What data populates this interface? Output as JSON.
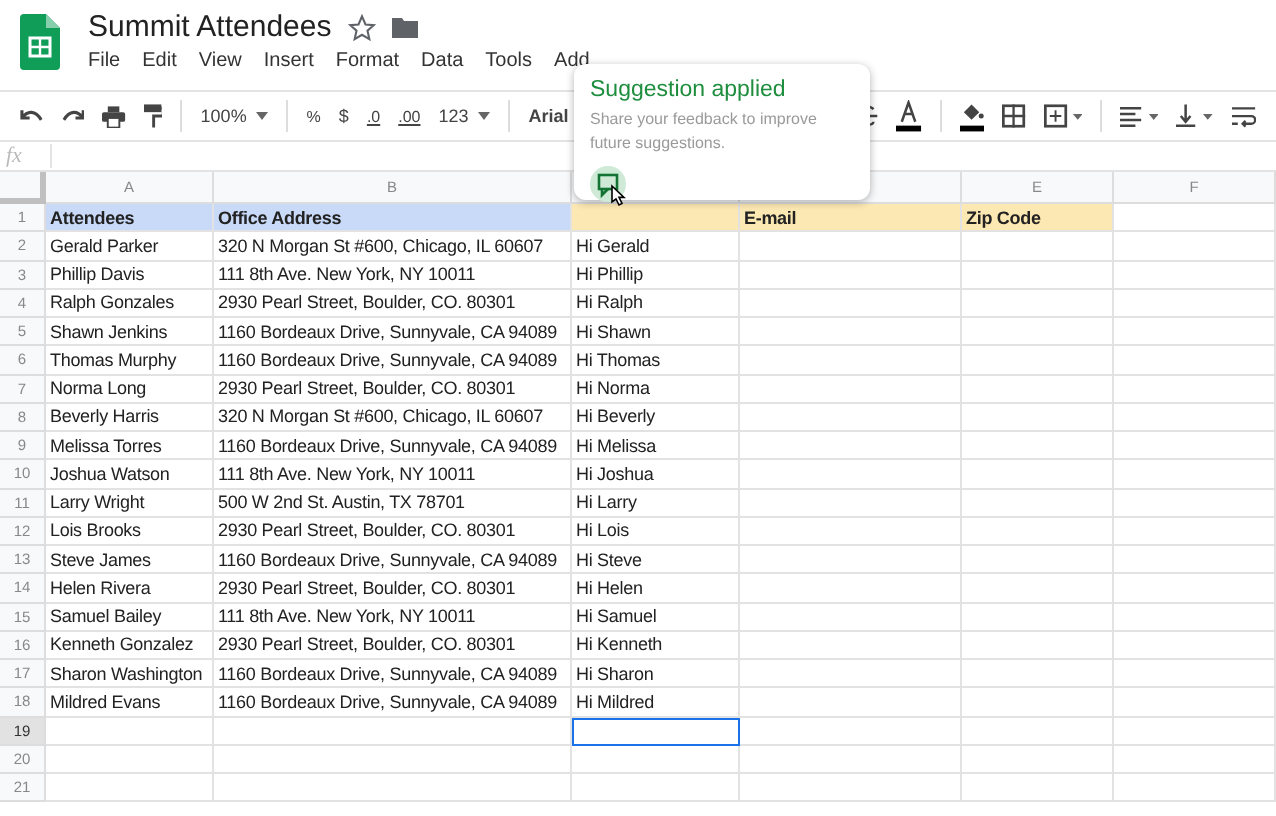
{
  "document": {
    "title": "Summit Attendees",
    "starred": false
  },
  "menu": [
    "File",
    "Edit",
    "View",
    "Insert",
    "Format",
    "Data",
    "Tools",
    "Add"
  ],
  "toolbar": {
    "zoom": "100%",
    "percent": "%",
    "currency": "$",
    "decrease_decimals": ".0",
    "increase_decimals": ".00",
    "number_format": "123",
    "font": "Arial"
  },
  "formula_bar": {
    "label": "fx"
  },
  "popup": {
    "title": "Suggestion applied",
    "message": "Share your feedback to improve future suggestions."
  },
  "columns": [
    {
      "label": "A"
    },
    {
      "label": "B"
    },
    {},
    {},
    {
      "label": "E"
    },
    {
      "label": "F"
    }
  ],
  "rows": [
    {
      "number": "1",
      "cells": [
        {
          "text": "Attendees",
          "color": "#c9daf8",
          "selected": false
        },
        {
          "text": "Office Address",
          "color": "#c9daf8",
          "selected": false
        },
        {
          "color": "#fce8b2",
          "selected": false
        },
        {
          "text": "E-mail",
          "color": "#fce8b2",
          "selected": false
        },
        {
          "text": "Zip Code",
          "color": "#fce8b2",
          "selected": false
        },
        {
          "selected": false
        }
      ]
    },
    {
      "number": "2",
      "cells": [
        {
          "text": "Gerald Parker",
          "selected": false
        },
        {
          "text": "320 N Morgan St #600, Chicago, IL 60607",
          "selected": false
        },
        {
          "text": "Hi Gerald",
          "selected": false
        },
        {
          "selected": false
        },
        {
          "selected": false
        },
        {
          "selected": false
        }
      ]
    },
    {
      "number": "3",
      "cells": [
        {
          "text": "Phillip Davis",
          "selected": false
        },
        {
          "text": "111 8th Ave. New York, NY 10011",
          "selected": false
        },
        {
          "text": "Hi Phillip",
          "selected": false
        },
        {
          "selected": false
        },
        {
          "selected": false
        },
        {
          "selected": false
        }
      ]
    },
    {
      "number": "4",
      "cells": [
        {
          "text": "Ralph Gonzales",
          "selected": false
        },
        {
          "text": "2930 Pearl Street, Boulder, CO. 80301",
          "selected": false
        },
        {
          "text": "Hi Ralph",
          "selected": false
        },
        {
          "selected": false
        },
        {
          "selected": false
        },
        {
          "selected": false
        }
      ]
    },
    {
      "number": "5",
      "cells": [
        {
          "text": "Shawn Jenkins",
          "selected": false
        },
        {
          "text": "1160 Bordeaux Drive, Sunnyvale, CA 94089",
          "selected": false
        },
        {
          "text": "Hi Shawn",
          "selected": false
        },
        {
          "selected": false
        },
        {
          "selected": false
        },
        {
          "selected": false
        }
      ]
    },
    {
      "number": "6",
      "cells": [
        {
          "text": "Thomas Murphy",
          "selected": false
        },
        {
          "text": "1160 Bordeaux Drive, Sunnyvale, CA 94089",
          "selected": false
        },
        {
          "text": "Hi Thomas",
          "selected": false
        },
        {
          "selected": false
        },
        {
          "selected": false
        },
        {
          "selected": false
        }
      ]
    },
    {
      "number": "7",
      "cells": [
        {
          "text": "Norma Long",
          "selected": false
        },
        {
          "text": "2930 Pearl Street, Boulder, CO. 80301",
          "selected": false
        },
        {
          "text": "Hi Norma",
          "selected": false
        },
        {
          "selected": false
        },
        {
          "selected": false
        },
        {
          "selected": false
        }
      ]
    },
    {
      "number": "8",
      "cells": [
        {
          "text": "Beverly Harris",
          "selected": false
        },
        {
          "text": "320 N Morgan St #600, Chicago, IL 60607",
          "selected": false
        },
        {
          "text": "Hi Beverly",
          "selected": false
        },
        {
          "selected": false
        },
        {
          "selected": false
        },
        {
          "selected": false
        }
      ]
    },
    {
      "number": "9",
      "cells": [
        {
          "text": "Melissa Torres",
          "selected": false
        },
        {
          "text": "1160 Bordeaux Drive, Sunnyvale, CA 94089",
          "selected": false
        },
        {
          "text": "Hi Melissa",
          "selected": false
        },
        {
          "selected": false
        },
        {
          "selected": false
        },
        {
          "selected": false
        }
      ]
    },
    {
      "number": "10",
      "cells": [
        {
          "text": "Joshua Watson",
          "selected": false
        },
        {
          "text": "111 8th Ave. New York, NY 10011",
          "selected": false
        },
        {
          "text": "Hi Joshua",
          "selected": false
        },
        {
          "selected": false
        },
        {
          "selected": false
        },
        {
          "selected": false
        }
      ]
    },
    {
      "number": "11",
      "cells": [
        {
          "text": "Larry Wright",
          "selected": false
        },
        {
          "text": "500 W 2nd St. Austin, TX 78701",
          "selected": false
        },
        {
          "text": "Hi Larry",
          "selected": false
        },
        {
          "selected": false
        },
        {
          "selected": false
        },
        {
          "selected": false
        }
      ]
    },
    {
      "number": "12",
      "cells": [
        {
          "text": "Lois Brooks",
          "selected": false
        },
        {
          "text": "2930 Pearl Street, Boulder, CO. 80301",
          "selected": false
        },
        {
          "text": "Hi Lois",
          "selected": false
        },
        {
          "selected": false
        },
        {
          "selected": false
        },
        {
          "selected": false
        }
      ]
    },
    {
      "number": "13",
      "cells": [
        {
          "text": "Steve James",
          "selected": false
        },
        {
          "text": "1160 Bordeaux Drive, Sunnyvale, CA 94089",
          "selected": false
        },
        {
          "text": "Hi Steve",
          "selected": false
        },
        {
          "selected": false
        },
        {
          "selected": false
        },
        {
          "selected": false
        }
      ]
    },
    {
      "number": "14",
      "cells": [
        {
          "text": "Helen Rivera",
          "selected": false
        },
        {
          "text": "2930 Pearl Street, Boulder, CO. 80301",
          "selected": false
        },
        {
          "text": "Hi Helen",
          "selected": false
        },
        {
          "selected": false
        },
        {
          "selected": false
        },
        {
          "selected": false
        }
      ]
    },
    {
      "number": "15",
      "cells": [
        {
          "text": "Samuel Bailey",
          "selected": false
        },
        {
          "text": "111 8th Ave. New York, NY 10011",
          "selected": false
        },
        {
          "text": "Hi Samuel",
          "selected": false
        },
        {
          "selected": false
        },
        {
          "selected": false
        },
        {
          "selected": false
        }
      ]
    },
    {
      "number": "16",
      "cells": [
        {
          "text": "Kenneth Gonzalez",
          "selected": false
        },
        {
          "text": "2930 Pearl Street, Boulder, CO. 80301",
          "selected": false
        },
        {
          "text": "Hi Kenneth",
          "selected": false
        },
        {
          "selected": false
        },
        {
          "selected": false
        },
        {
          "selected": false
        }
      ]
    },
    {
      "number": "17",
      "cells": [
        {
          "text": "Sharon Washington",
          "selected": false
        },
        {
          "text": "1160 Bordeaux Drive, Sunnyvale, CA 94089",
          "selected": false
        },
        {
          "text": "Hi Sharon",
          "selected": false
        },
        {
          "selected": false
        },
        {
          "selected": false
        },
        {
          "selected": false
        }
      ]
    },
    {
      "number": "18",
      "cells": [
        {
          "text": "Mildred Evans",
          "selected": false
        },
        {
          "text": "1160 Bordeaux Drive, Sunnyvale, CA 94089",
          "selected": false
        },
        {
          "text": "Hi Mildred",
          "selected": false
        },
        {
          "selected": false
        },
        {
          "selected": false
        },
        {
          "selected": false
        }
      ]
    },
    {
      "number": "19",
      "cells": [
        {
          "selected": false
        },
        {
          "selected": false
        },
        {
          "selected": true
        },
        {
          "selected": false
        },
        {
          "selected": false
        },
        {
          "selected": false
        }
      ]
    },
    {
      "number": "20",
      "cells": [
        {
          "selected": false
        },
        {
          "selected": false
        },
        {
          "selected": false
        },
        {
          "selected": false
        },
        {
          "selected": false
        },
        {
          "selected": false
        }
      ]
    },
    {
      "number": "21",
      "cells": [
        {
          "selected": false
        },
        {
          "selected": false
        },
        {
          "selected": false
        },
        {
          "selected": false
        },
        {
          "selected": false
        },
        {
          "selected": false
        }
      ]
    }
  ]
}
